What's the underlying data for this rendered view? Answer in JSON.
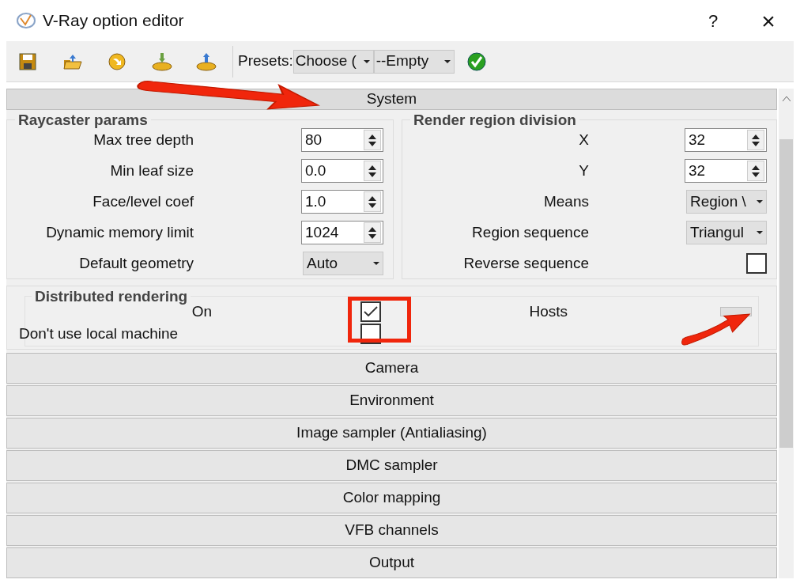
{
  "window": {
    "title": "V-Ray option editor",
    "help": "?",
    "close": "×"
  },
  "toolbar": {
    "presets_label": "Presets:",
    "presets": [
      {
        "value": "Choose ("
      },
      {
        "value": "--Empty"
      }
    ]
  },
  "system": {
    "title": "System"
  },
  "raycaster": {
    "title": "Raycaster params",
    "rows": [
      {
        "kind": "spin",
        "label": "Max tree depth",
        "value": "80"
      },
      {
        "kind": "spin",
        "label": "Min leaf size",
        "value": "0.0"
      },
      {
        "kind": "spin",
        "label": "Face/level coef",
        "value": "1.0"
      },
      {
        "kind": "spin",
        "label": "Dynamic memory limit",
        "value": "1024"
      },
      {
        "kind": "select",
        "label": "Default geometry",
        "value": "Auto"
      }
    ]
  },
  "region": {
    "title": "Render region division",
    "rows": [
      {
        "kind": "spin",
        "label": "X",
        "value": "32"
      },
      {
        "kind": "spin",
        "label": "Y",
        "value": "32"
      },
      {
        "kind": "select",
        "label": "Means",
        "value": "Region \\"
      },
      {
        "kind": "select",
        "label": "Region sequence",
        "value": "Triangul"
      },
      {
        "kind": "check",
        "label": "Reverse sequence",
        "checked": false
      }
    ]
  },
  "distributed": {
    "title": "Distributed rendering",
    "on": {
      "label": "On",
      "checked": true
    },
    "local": {
      "label": "Don't use local machine",
      "checked": false
    },
    "hosts": {
      "label": "Hosts"
    }
  },
  "sections": [
    {
      "title": "Camera"
    },
    {
      "title": "Environment"
    },
    {
      "title": "Image sampler (Antialiasing)"
    },
    {
      "title": "DMC sampler"
    },
    {
      "title": "Color mapping"
    },
    {
      "title": "VFB channels"
    },
    {
      "title": "Output"
    }
  ]
}
